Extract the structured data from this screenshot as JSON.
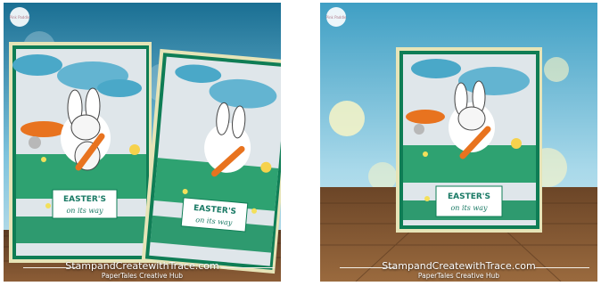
{
  "images": [
    {
      "id": "left",
      "card_text": {
        "line1": "EASTER'S",
        "line2": "on its way"
      },
      "second_card_text": {
        "line1": "EASTER'S",
        "line2": "on its way"
      },
      "badge": "Pink Paddle",
      "credit": {
        "main": "StampandCreatewithTrace.com",
        "sub": "PaperTales Creative Hub"
      }
    },
    {
      "id": "right",
      "card_text": {
        "line1": "EASTER'S",
        "line2": "on its way"
      },
      "badge": "Pink Paddle",
      "credit": {
        "main": "StampandCreatewithTrace.com",
        "sub": "PaperTales Creative Hub"
      }
    }
  ],
  "colors": {
    "cloud": "#4aa8c8",
    "grass": "#1b9a64",
    "carrot": "#e8731f",
    "wood": "#8a5a33",
    "frame": "#0f7d55"
  }
}
